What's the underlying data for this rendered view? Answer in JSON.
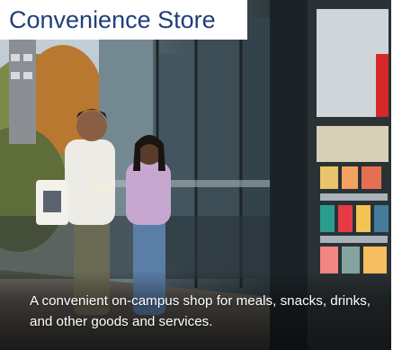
{
  "card": {
    "title": "Convenience Store",
    "description": "A convenient on-campus shop for meals, snacks, drinks, and other goods and services."
  },
  "colors": {
    "title": "#1f3f7a",
    "caption_text": "#ffffff"
  }
}
